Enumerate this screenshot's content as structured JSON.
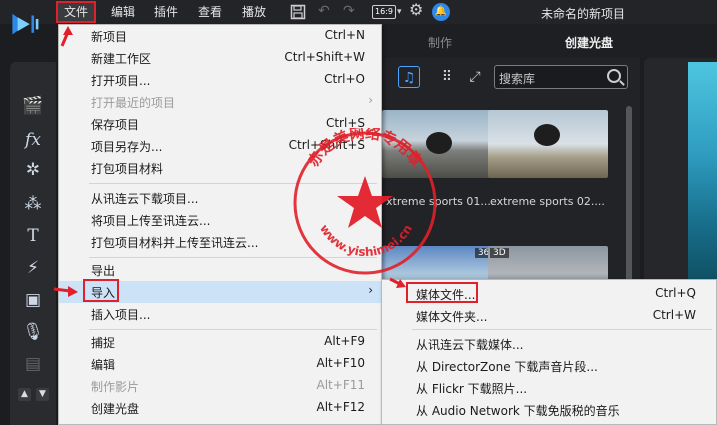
{
  "menubar": {
    "items": [
      "文件",
      "编辑",
      "插件",
      "查看",
      "播放"
    ],
    "ratio_label": "16:9",
    "window_title": "未命名的新项目"
  },
  "mode_tabs": [
    "制作",
    "创建光盘"
  ],
  "library": {
    "search_placeholder": "搜索库",
    "thumbnails": [
      {
        "caption": "xtreme sports 01...."
      },
      {
        "caption": "extreme sports 02...."
      },
      {
        "badge": "360"
      },
      {
        "badge": "3D"
      }
    ]
  },
  "file_menu": [
    {
      "label": "新项目",
      "shortcut": "Ctrl+N"
    },
    {
      "label": "新建工作区",
      "shortcut": "Ctrl+Shift+W"
    },
    {
      "label": "打开项目...",
      "shortcut": "Ctrl+O"
    },
    {
      "label": "打开最近的项目",
      "shortcut": ""
    },
    {
      "label": "保存项目",
      "shortcut": "Ctrl+S"
    },
    {
      "label": "项目另存为...",
      "shortcut": "Ctrl+Shift+S"
    },
    {
      "label": "打包项目材料",
      "shortcut": ""
    },
    {
      "label": "从讯连云下载项目...",
      "shortcut": ""
    },
    {
      "label": "将项目上传至讯连云...",
      "shortcut": ""
    },
    {
      "label": "打包项目材料并上传至讯连云...",
      "shortcut": ""
    },
    {
      "label": "导出",
      "shortcut": ""
    },
    {
      "label": "导入",
      "shortcut": ""
    },
    {
      "label": "插入项目...",
      "shortcut": ""
    },
    {
      "label": "捕捉",
      "shortcut": "Alt+F9"
    },
    {
      "label": "编辑",
      "shortcut": "Alt+F10"
    },
    {
      "label": "制作影片",
      "shortcut": "Alt+F11"
    },
    {
      "label": "创建光盘",
      "shortcut": "Alt+F12"
    }
  ],
  "import_submenu": [
    {
      "label": "媒体文件...",
      "shortcut": "Ctrl+Q"
    },
    {
      "label": "媒体文件夹...",
      "shortcut": "Ctrl+W"
    },
    {
      "label": "从讯连云下载媒体...",
      "shortcut": ""
    },
    {
      "label": "从 DirectorZone 下载声音片段...",
      "shortcut": ""
    },
    {
      "label": "从 Flickr 下载照片...",
      "shortcut": ""
    },
    {
      "label": "从 Audio Network 下载免版税的音乐",
      "shortcut": ""
    }
  ],
  "watermark": {
    "top_text": "赤是美网络专用章",
    "bottom_text": "www.yishimei.cn",
    "color": "#e0202a"
  },
  "colors": {
    "accent_blue": "#4aa3ff",
    "highlight": "#cce2f7",
    "annotation_red": "#e0202a"
  }
}
